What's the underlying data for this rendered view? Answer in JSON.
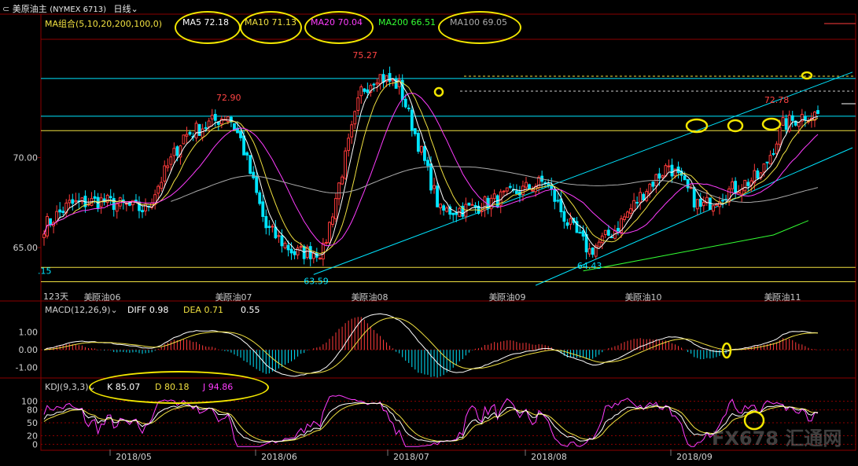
{
  "window": {
    "symbol": "美原油主",
    "symbol_code": "(NYMEX 6713)",
    "period": "日线"
  },
  "colors": {
    "up": "#ff3b3b",
    "down": "#00e5ff",
    "ma5": "#ffffff",
    "ma10": "#f0e040",
    "ma20": "#ff3cff",
    "ma100": "#aaaaaa",
    "ma200": "#33ff33",
    "grid": "#8b0000",
    "annotation": "#f2e600"
  },
  "chart_data": [
    {
      "type": "candlestick",
      "panel": "price",
      "indicator_label": "MA组合(5,10,20,200,100,0)",
      "ma_values": [
        {
          "name": "MA5",
          "value": "72.18"
        },
        {
          "name": "MA10",
          "value": "71.13"
        },
        {
          "name": "MA20",
          "value": "70.04"
        },
        {
          "name": "MA200",
          "value": "66.51"
        },
        {
          "name": "MA100",
          "value": "69.05"
        }
      ],
      "y_ticks": [
        "70.00",
        "65.00"
      ],
      "ylim": [
        62.6,
        77.1
      ],
      "extreme_labels": [
        {
          "text": "72.90",
          "x": 58.2,
          "y": 72.9
        },
        {
          "text": "75.27",
          "x": 101.2,
          "y": 75.27
        },
        {
          "text": "72.78",
          "x": 231.0,
          "y": 72.78
        },
        {
          "text": "64.43",
          "x": 172.0,
          "y": 64.43
        },
        {
          "text": "63.59",
          "x": 85.8,
          "y": 63.59
        },
        {
          "text": ".15",
          "x": 0.2,
          "y": 64.15
        }
      ],
      "bar_count_label": "123天",
      "contract_labels": [
        {
          "text": "美原油06",
          "x": 11
        },
        {
          "text": "美原油07",
          "x": 56
        },
        {
          "text": "美原油08",
          "x": 97
        },
        {
          "text": "美原油09",
          "x": 140
        },
        {
          "text": "美原油10",
          "x": 182
        },
        {
          "text": "美原油11",
          "x": 225
        }
      ],
      "horizontal_levels": [
        {
          "y": 74.4,
          "color": "#00e5ff"
        },
        {
          "y": 72.3,
          "color": "#00e5ff"
        },
        {
          "y": 71.5,
          "color": "#f0e040"
        },
        {
          "y": 63.9,
          "color": "#f0e040"
        },
        {
          "y": 63.1,
          "color": "#f0e040"
        }
      ],
      "trend_lines": [
        {
          "from": [
            85,
            63.5
          ],
          "to": [
            245,
            74.4
          ],
          "color": "#00e5ff"
        },
        {
          "from": [
            155,
            62.9
          ],
          "to": [
            245,
            70.2
          ],
          "color": "#00e5ff"
        }
      ],
      "series_ma": [
        {
          "name": "MA200",
          "points": [
            [
              170,
              63.7
            ],
            [
              200,
              64.7
            ],
            [
              230,
              65.7
            ],
            [
              241,
              66.5
            ]
          ]
        }
      ]
    },
    {
      "type": "macd",
      "panel": "macd",
      "indicator_label": "MACD(12,26,9)",
      "values": {
        "DIFF": "0.98",
        "DEA": "0.71",
        "MACD": "0.55"
      },
      "y_ticks": [
        "1.00",
        "0.00",
        "-1.00"
      ],
      "ylim": [
        -1.55,
        2.1
      ]
    },
    {
      "type": "kdj",
      "panel": "kdj",
      "indicator_label": "KDJ(9,3,3)",
      "values": {
        "K": "85.07",
        "D": "80.18",
        "J": "94.86"
      },
      "y_ticks": [
        "100",
        "80",
        "50",
        "20",
        "0"
      ],
      "ylim": [
        -12,
        125
      ]
    }
  ],
  "x_axis": {
    "dates": [
      {
        "label": "2018/05",
        "x": 25
      },
      {
        "label": "2018/06",
        "x": 68
      },
      {
        "label": "2018/07",
        "x": 107
      },
      {
        "label": "2018/08",
        "x": 149
      },
      {
        "label": "2018/09",
        "x": 192
      }
    ]
  },
  "watermark": "FX678 汇通网"
}
